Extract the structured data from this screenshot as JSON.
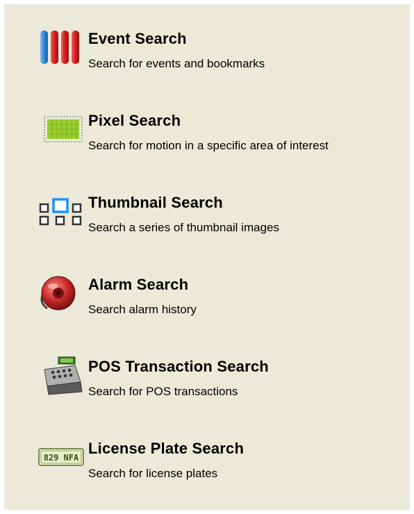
{
  "items": [
    {
      "title": "Event Search",
      "description": "Search for events and bookmarks",
      "icon": "event-bars-icon"
    },
    {
      "title": "Pixel Search",
      "description": "Search for motion in a specific area of interest",
      "icon": "pixel-area-icon"
    },
    {
      "title": "Thumbnail Search",
      "description": "Search a series of thumbnail images",
      "icon": "thumbnail-grid-icon"
    },
    {
      "title": "Alarm Search",
      "description": "Search alarm history",
      "icon": "alarm-bell-icon"
    },
    {
      "title": "POS Transaction Search",
      "description": "Search for POS transactions",
      "icon": "cash-register-icon"
    },
    {
      "title": "License Plate Search",
      "description": "Search for license plates",
      "icon": "license-plate-icon",
      "plate_text": "829 NFA"
    }
  ],
  "colors": {
    "background": "#ECE9D8",
    "event_blue": "#3a8ed8",
    "event_red": "#d42020",
    "pixel_green": "#9acd32",
    "thumb_blue": "#1e90ff"
  }
}
